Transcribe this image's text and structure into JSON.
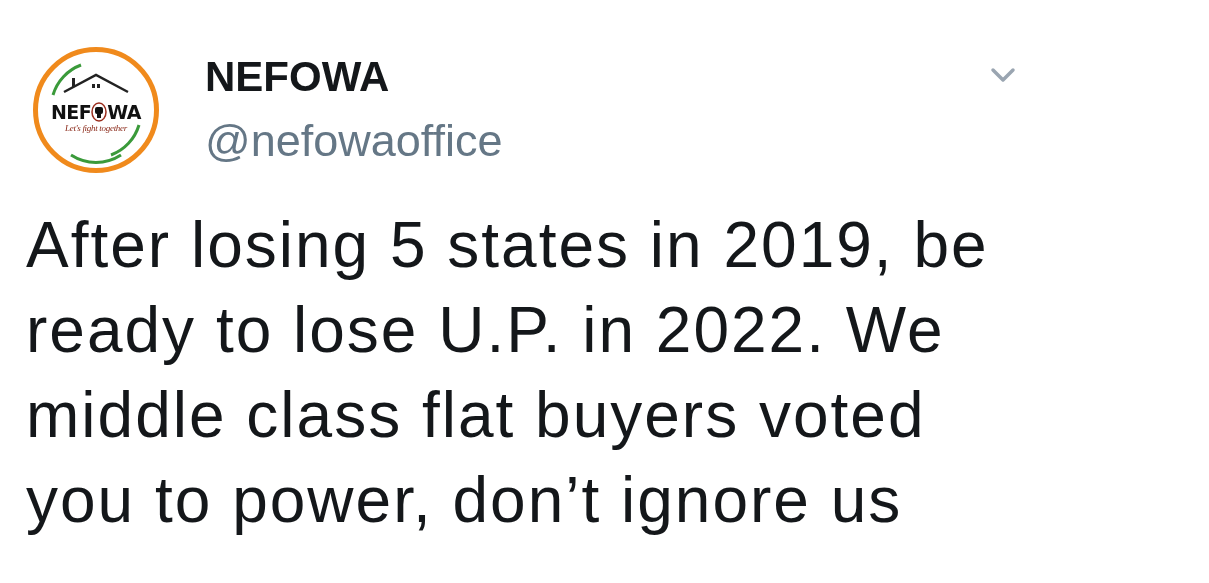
{
  "tweet": {
    "avatar": {
      "logo_left": "NEF",
      "logo_right": "WA",
      "tagline": "Let's fight together"
    },
    "display_name": "NEFOWA",
    "handle": "@nefowaoffice",
    "text": "After losing 5 states in 2019, be ready to lose U.P. in 2022. We middle class flat buyers voted you to power, don’t ignore us"
  }
}
